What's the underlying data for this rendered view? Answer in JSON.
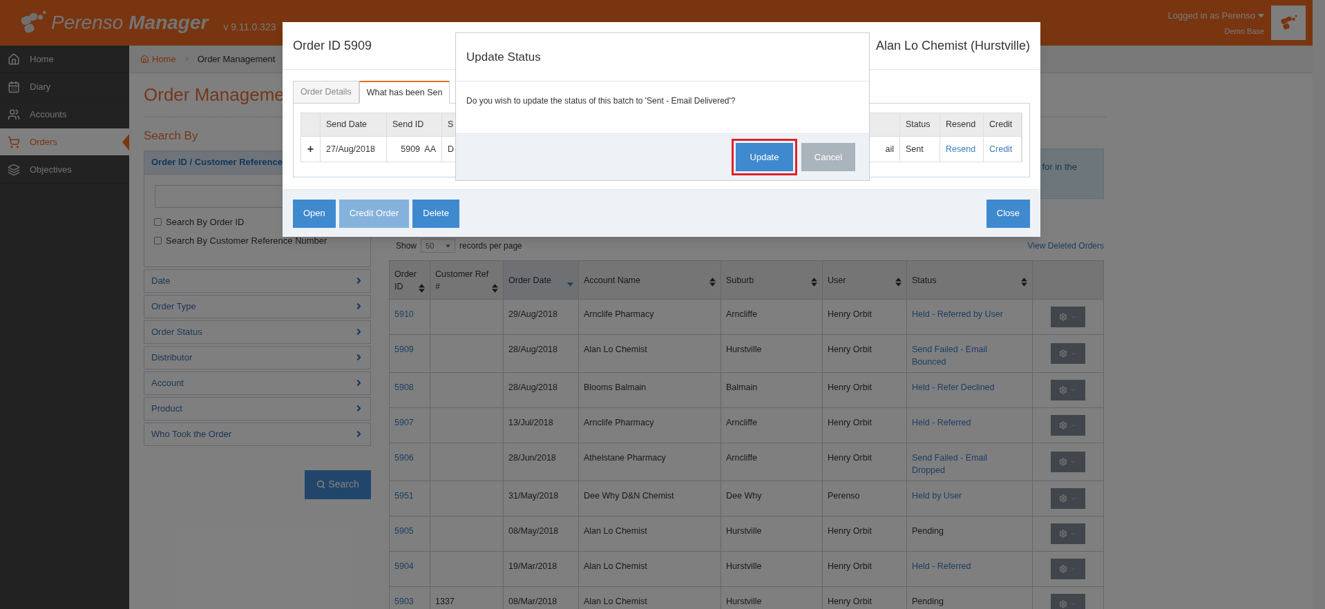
{
  "header": {
    "brand": "Perenso",
    "product": "Manager",
    "version": "v 9.11.0.323",
    "user": "Logged in as Perenso",
    "base": "Demo Base"
  },
  "sidebar": {
    "items": [
      {
        "label": "Home",
        "selected": false
      },
      {
        "label": "Diary",
        "selected": false
      },
      {
        "label": "Accounts",
        "selected": false
      },
      {
        "label": "Orders",
        "selected": true
      },
      {
        "label": "Objectives",
        "selected": false
      }
    ]
  },
  "breadcrumb": [
    "Home",
    "Order Management"
  ],
  "page_title": "Order Manageme",
  "search_panel": {
    "title": "Search By",
    "section": "Order ID / Customer Reference",
    "checkboxes": [
      {
        "label": "Search By Order ID",
        "checked": false
      },
      {
        "label": "Search By Customer Reference Number",
        "checked": false
      }
    ],
    "filters": [
      "Date",
      "Order Type",
      "Order Status",
      "Distributor",
      "Account",
      "Product",
      "Who Took the Order"
    ],
    "button": "Search"
  },
  "info_box": "for in the",
  "table_controls": {
    "show": "Show",
    "page_size": "50",
    "suffix": "records per page",
    "deleted_link": "View Deleted Orders"
  },
  "orders_table": {
    "columns": [
      {
        "label": "Order ID",
        "sorted": false
      },
      {
        "label": "Customer Ref #",
        "sorted": false
      },
      {
        "label": "Order Date",
        "sorted": true
      },
      {
        "label": "Account Name",
        "sorted": false
      },
      {
        "label": "Suburb",
        "sorted": false
      },
      {
        "label": "User",
        "sorted": false
      },
      {
        "label": "Status",
        "sorted": false
      }
    ],
    "rows": [
      {
        "order_id": "5910",
        "order_date": "29/Aug/2018",
        "account": "Arnclife Pharmacy",
        "suburb": "Arncliffe",
        "user": "Henry Orbit",
        "status": "Held - Referred by User",
        "linked": true
      },
      {
        "order_id": "5909",
        "order_date": "28/Aug/2018",
        "account": "Alan Lo Chemist",
        "suburb": "Hurstville",
        "user": "Henry Orbit",
        "status": "Send Failed - Email Bounced",
        "linked": true
      },
      {
        "order_id": "5908",
        "order_date": "28/Aug/2018",
        "account": "Blooms Balmain",
        "suburb": "Balmain",
        "user": "Henry Orbit",
        "status": "Held - Refer Declined",
        "linked": true
      },
      {
        "order_id": "5907",
        "order_date": "13/Jul/2018",
        "account": "Arnclife Pharmacy",
        "suburb": "Arncliffe",
        "user": "Henry Orbit",
        "status": "Held - Referred",
        "linked": true
      },
      {
        "order_id": "5906",
        "order_date": "28/Jun/2018",
        "account": "Athelstane Pharmacy",
        "suburb": "Arncliffe",
        "user": "Henry Orbit",
        "status": "Send Failed - Email Dropped",
        "linked": true
      },
      {
        "order_id": "5951",
        "order_date": "31/May/2018",
        "account": "Dee Why D&N Chemist",
        "suburb": "Dee Why",
        "user": "Perenso",
        "status": "Held by User",
        "linked": true
      },
      {
        "order_id": "5905",
        "order_date": "08/May/2018",
        "account": "Alan Lo Chemist",
        "suburb": "Hurstville",
        "user": "Henry Orbit",
        "status": "Pending",
        "linked": false
      },
      {
        "order_id": "5904",
        "order_date": "19/Mar/2018",
        "account": "Alan Lo Chemist",
        "suburb": "Hurstville",
        "user": "Henry Orbit",
        "status": "Held - Referred",
        "linked": true
      },
      {
        "order_id": "5903",
        "customer_ref": "1337",
        "order_date": "08/Mar/2018",
        "account": "Alan Lo Chemist",
        "suburb": "Hurstville",
        "user": "Henry Orbit",
        "status": "Pending",
        "linked": false
      }
    ]
  },
  "order_modal": {
    "title": "Order ID 5909",
    "account": "Alan Lo Chemist (Hurstville)",
    "tabs": [
      {
        "label": "Order Details",
        "selected": false
      },
      {
        "label": "What has been Sen",
        "selected": true
      }
    ],
    "send_table": {
      "header_left": [
        "Send Date",
        "Send ID",
        "S"
      ],
      "header_right": [
        "Status",
        "Resend",
        "Credit"
      ],
      "row": {
        "expander": "+",
        "left": [
          "27/Aug/2018",
          "5909  AA",
          "D"
        ],
        "tail": "ail",
        "right": [
          {
            "text": "Sent",
            "link": false
          },
          {
            "text": "Resend",
            "link": true
          },
          {
            "text": "Credit",
            "link": true
          }
        ]
      }
    },
    "buttons": [
      {
        "label": "Open",
        "disabled": false
      },
      {
        "label": "Credit Order",
        "disabled": true
      },
      {
        "label": "Delete",
        "disabled": false
      }
    ],
    "close": "Close"
  },
  "update_dialog": {
    "title": "Update Status",
    "message": "Do you wish to update the status of this batch to 'Sent - Email Delivered'?",
    "buttons": [
      {
        "label": "Update",
        "kind": "primary",
        "highlighted": true
      },
      {
        "label": "Cancel",
        "kind": "secondary",
        "highlighted": false
      }
    ]
  }
}
